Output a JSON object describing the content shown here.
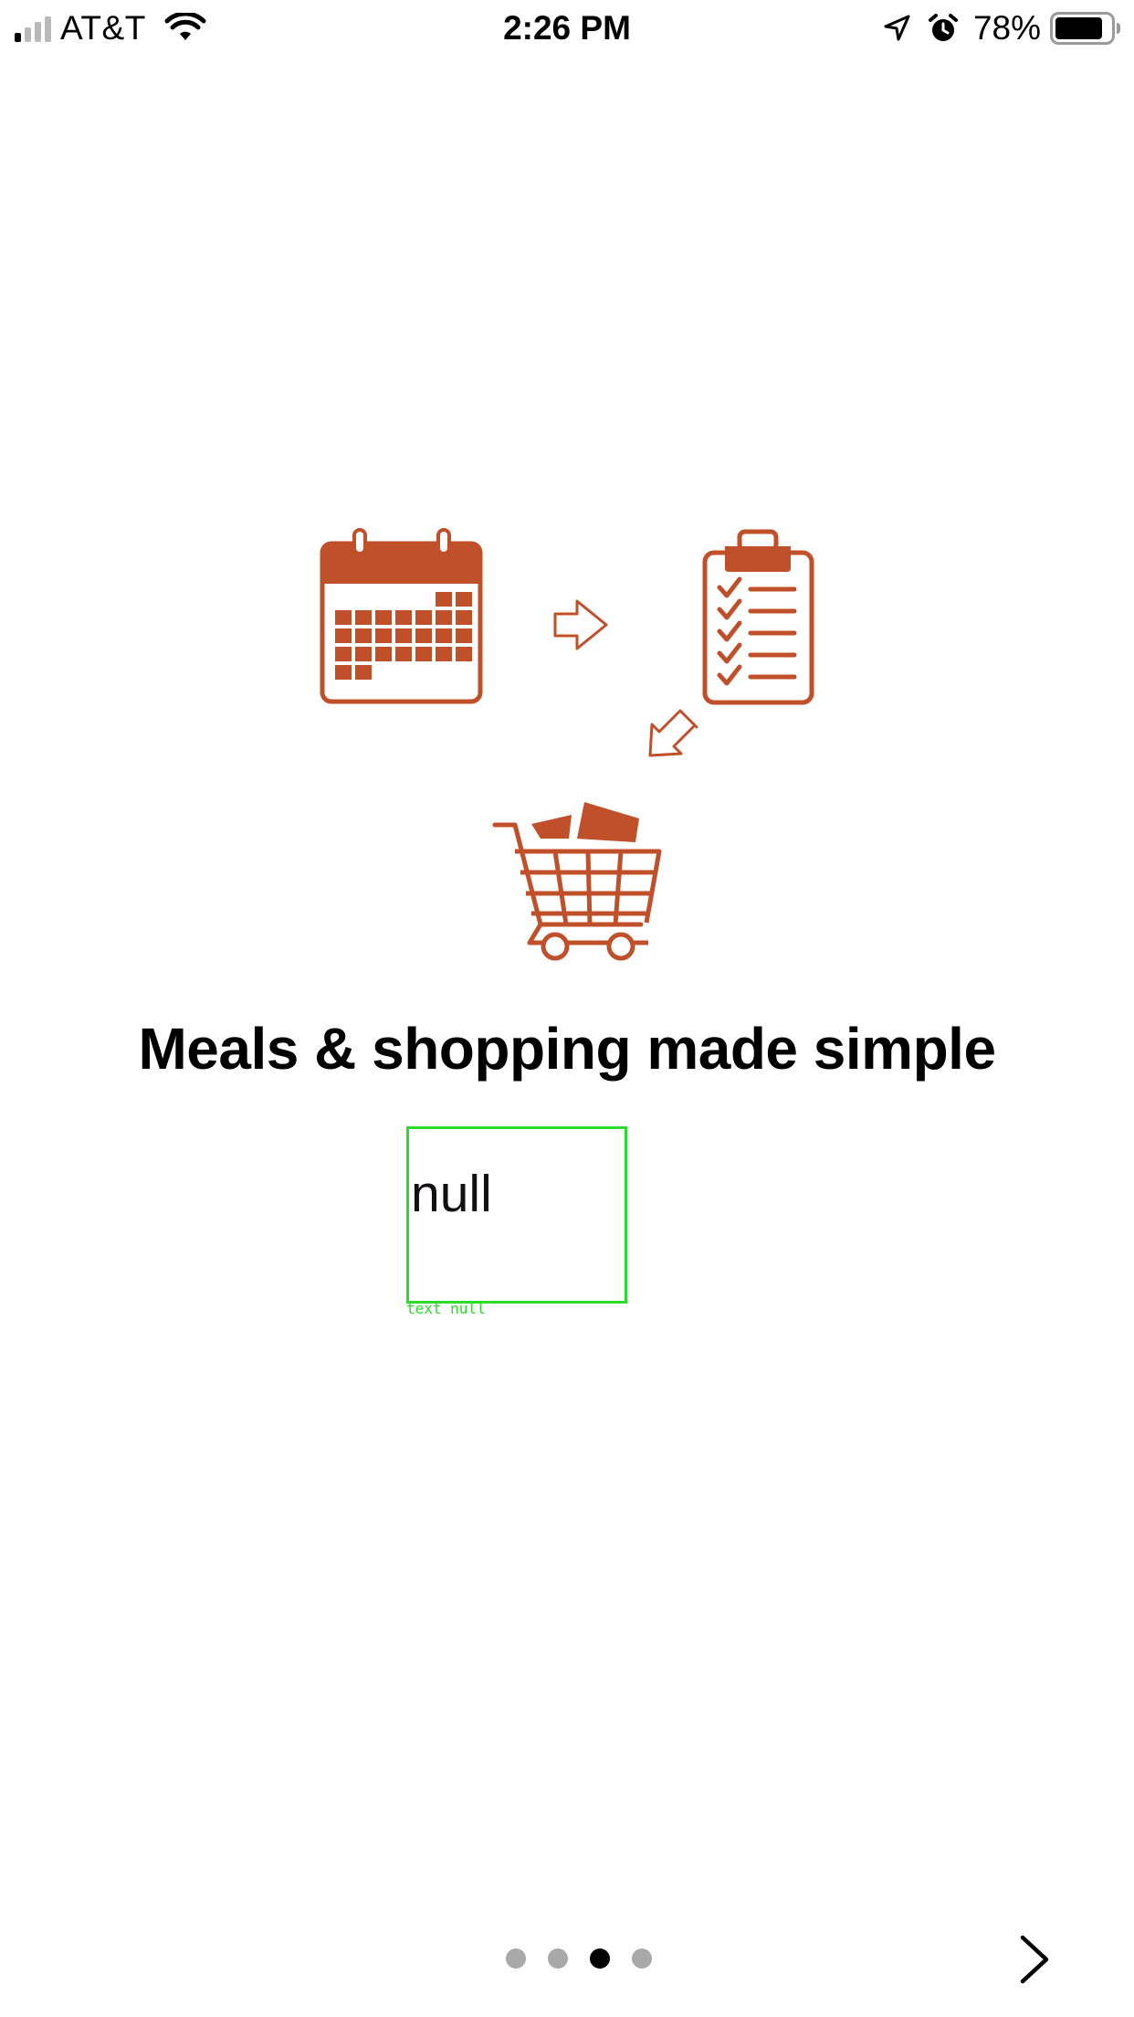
{
  "status_bar": {
    "carrier": "AT&T",
    "time": "2:26 PM",
    "battery_percent": "78%",
    "signal_bars_active": 1,
    "signal_bars_total": 4,
    "battery_level": 0.78,
    "icons": [
      "signal-icon",
      "wifi-icon",
      "location-icon",
      "alarm-icon",
      "battery-icon"
    ]
  },
  "illustration": {
    "icons": [
      "calendar-icon",
      "arrow-right-icon",
      "clipboard-checklist-icon",
      "arrow-down-left-icon",
      "shopping-cart-icon"
    ],
    "accent_color": "#c0502a"
  },
  "onboarding": {
    "headline": "Meals & shopping made simple",
    "body": "null",
    "debug_caption": "text null"
  },
  "pager": {
    "total_pages": 4,
    "current_page": 3,
    "active_color": "#000000",
    "inactive_color": "#a9a9a9"
  },
  "navigation": {
    "next_icon": "chevron-right-icon"
  }
}
